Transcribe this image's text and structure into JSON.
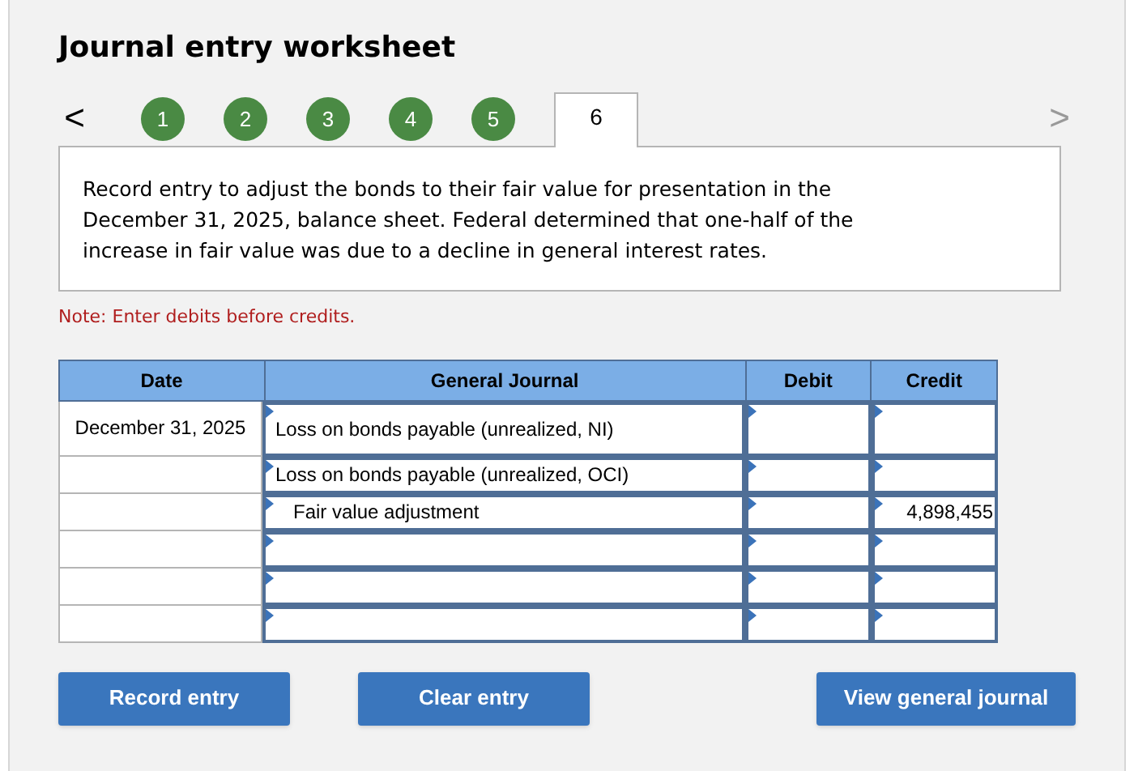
{
  "title": "Journal entry worksheet",
  "nav": {
    "prev": "<",
    "next": ">"
  },
  "steps": [
    {
      "label": "1",
      "selected": false
    },
    {
      "label": "2",
      "selected": false
    },
    {
      "label": "3",
      "selected": false
    },
    {
      "label": "4",
      "selected": false
    },
    {
      "label": "5",
      "selected": false
    },
    {
      "label": "6",
      "selected": true
    }
  ],
  "instruction": "Record entry to adjust the bonds to their fair value for presentation in the December 31, 2025, balance sheet. Federal determined that one-half of the increase in fair value was due to a decline in general interest rates.",
  "note": "Note: Enter debits before credits.",
  "table": {
    "columns": [
      "Date",
      "General Journal",
      "Debit",
      "Credit"
    ],
    "rows": [
      {
        "date": "December 31, 2025",
        "account": "Loss on bonds payable (unrealized, NI)",
        "indented": false,
        "debit": "",
        "credit": ""
      },
      {
        "date": "",
        "account": "Loss on bonds payable (unrealized, OCI)",
        "indented": false,
        "debit": "",
        "credit": ""
      },
      {
        "date": "",
        "account": "Fair value adjustment",
        "indented": true,
        "debit": "",
        "credit": "4,898,455"
      },
      {
        "date": "",
        "account": "",
        "debit": "",
        "credit": ""
      },
      {
        "date": "",
        "account": "",
        "debit": "",
        "credit": ""
      },
      {
        "date": "",
        "account": "",
        "debit": "",
        "credit": ""
      }
    ]
  },
  "buttons": [
    "Record entry",
    "Clear entry",
    "View general journal"
  ]
}
